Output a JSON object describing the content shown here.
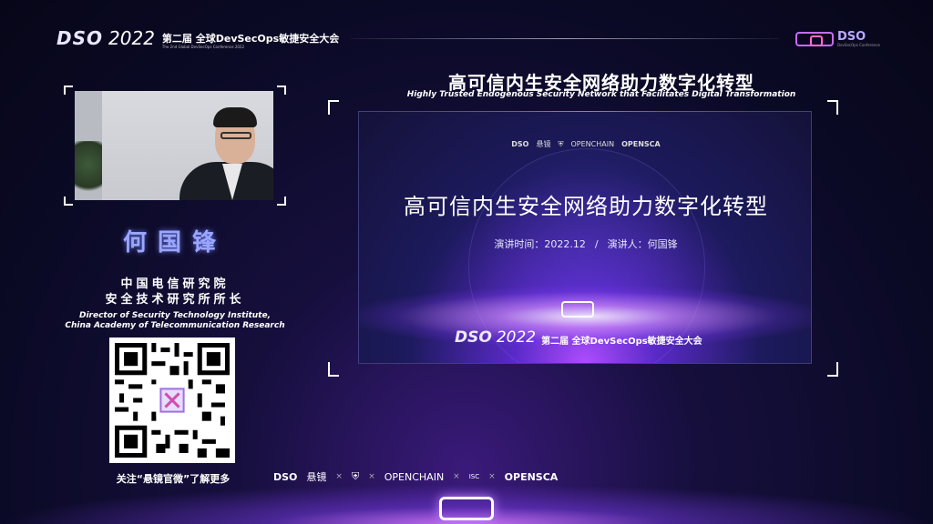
{
  "header": {
    "brand_dso": "DSO",
    "brand_year": "2022",
    "conference_cn": "第二届 全球DevSecOps敏捷安全大会",
    "conference_en": "The 2nd Global DevSecOps Conference 2022",
    "right_logo": "DSO",
    "right_logo_sub": "DevSecOps Conference"
  },
  "speaker": {
    "name": "何国锋",
    "org_line1": "中国电信研究院",
    "org_line2": "安全技术研究所所长",
    "title_en_line1": "Director of Security Technology Institute,",
    "title_en_line2": "China Academy of Telecommunication Research"
  },
  "qr": {
    "caption": "关注“悬镜官微”了解更多"
  },
  "talk": {
    "title_cn": "高可信内生安全网络助力数字化转型",
    "title_en": "Highly Trusted Endogenous Security Network that Facilitates Digital Transformation"
  },
  "slide": {
    "logo_dso": "DSO",
    "logo_xj": "悬镜",
    "logo_openchain": "OPENCHAIN",
    "logo_opensca": "OPENSCA",
    "title": "高可信内生安全网络助力数字化转型",
    "time_label": "演讲时间：2022.12",
    "separator": "/",
    "speaker_label": "演讲人：何国锋",
    "brand_dso": "DSO",
    "brand_year": "2022",
    "brand_conf": "第二届 全球DevSecOps敏捷安全大会"
  },
  "sponsors": {
    "dso": "DSO",
    "xj": "悬镜",
    "openchain": "OPENCHAIN",
    "isc": "ISC",
    "opensca": "OPENSCA",
    "times": "×"
  },
  "colors": {
    "accent": "#9aa6ff",
    "glow": "#c080ff",
    "background": "#0b0a26"
  }
}
